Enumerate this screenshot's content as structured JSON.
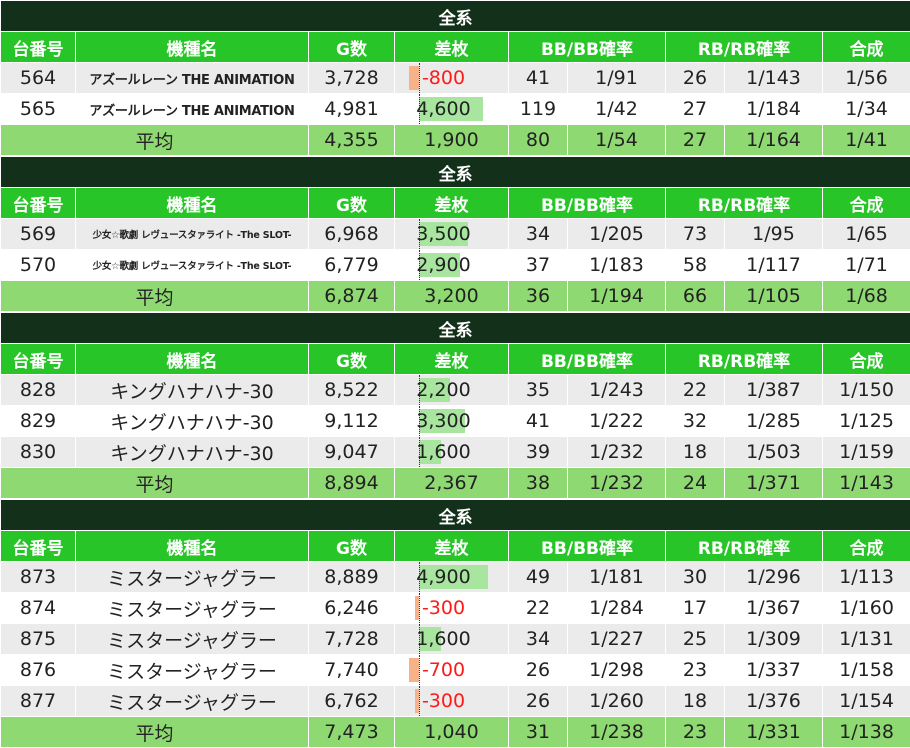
{
  "groups": [
    {
      "title": "全系",
      "headers": [
        "台番号",
        "機種名",
        "G数",
        "差枚",
        "BB/BB確率",
        "RB/RB確率",
        "合成"
      ],
      "rows": [
        {
          "num": "564",
          "name": "アズールレーン THE ANIMATION",
          "name_size": "small",
          "games": "3,728",
          "diff": "-800",
          "diff_value": -800,
          "bb": "41",
          "bb_rate": "1/91",
          "rb": "26",
          "rb_rate": "1/143",
          "total": "1/56"
        },
        {
          "num": "565",
          "name": "アズールレーン THE ANIMATION",
          "name_size": "small",
          "games": "4,981",
          "diff": "4,600",
          "diff_value": 4600,
          "bb": "119",
          "bb_rate": "1/42",
          "rb": "27",
          "rb_rate": "1/184",
          "total": "1/34"
        }
      ],
      "avg": {
        "label": "平均",
        "games": "4,355",
        "diff": "1,900",
        "bb": "80",
        "bb_rate": "1/54",
        "rb": "27",
        "rb_rate": "1/164",
        "total": "1/41"
      }
    },
    {
      "title": "全系",
      "headers": [
        "台番号",
        "機種名",
        "G数",
        "差枚",
        "BB/BB確率",
        "RB/RB確率",
        "合成"
      ],
      "rows": [
        {
          "num": "569",
          "name": "少女☆歌劇 レヴュースタァライト -The SLOT-",
          "name_size": "tiny",
          "games": "6,968",
          "diff": "3,500",
          "diff_value": 3500,
          "bb": "34",
          "bb_rate": "1/205",
          "rb": "73",
          "rb_rate": "1/95",
          "total": "1/65"
        },
        {
          "num": "570",
          "name": "少女☆歌劇 レヴュースタァライト -The SLOT-",
          "name_size": "tiny",
          "games": "6,779",
          "diff": "2,900",
          "diff_value": 2900,
          "bb": "37",
          "bb_rate": "1/183",
          "rb": "58",
          "rb_rate": "1/117",
          "total": "1/71"
        }
      ],
      "avg": {
        "label": "平均",
        "games": "6,874",
        "diff": "3,200",
        "bb": "36",
        "bb_rate": "1/194",
        "rb": "66",
        "rb_rate": "1/105",
        "total": "1/68"
      }
    },
    {
      "title": "全系",
      "headers": [
        "台番号",
        "機種名",
        "G数",
        "差枚",
        "BB/BB確率",
        "RB/RB確率",
        "合成"
      ],
      "rows": [
        {
          "num": "828",
          "name": "キングハナハナ-30",
          "name_size": "normal",
          "games": "8,522",
          "diff": "2,200",
          "diff_value": 2200,
          "bb": "35",
          "bb_rate": "1/243",
          "rb": "22",
          "rb_rate": "1/387",
          "total": "1/150"
        },
        {
          "num": "829",
          "name": "キングハナハナ-30",
          "name_size": "normal",
          "games": "9,112",
          "diff": "3,300",
          "diff_value": 3300,
          "bb": "41",
          "bb_rate": "1/222",
          "rb": "32",
          "rb_rate": "1/285",
          "total": "1/125"
        },
        {
          "num": "830",
          "name": "キングハナハナ-30",
          "name_size": "normal",
          "games": "9,047",
          "diff": "1,600",
          "diff_value": 1600,
          "bb": "39",
          "bb_rate": "1/232",
          "rb": "18",
          "rb_rate": "1/503",
          "total": "1/159"
        }
      ],
      "avg": {
        "label": "平均",
        "games": "8,894",
        "diff": "2,367",
        "bb": "38",
        "bb_rate": "1/232",
        "rb": "24",
        "rb_rate": "1/371",
        "total": "1/143"
      }
    },
    {
      "title": "全系",
      "headers": [
        "台番号",
        "機種名",
        "G数",
        "差枚",
        "BB/BB確率",
        "RB/RB確率",
        "合成"
      ],
      "rows": [
        {
          "num": "873",
          "name": "ミスタージャグラー",
          "name_size": "normal",
          "games": "8,889",
          "diff": "4,900",
          "diff_value": 4900,
          "bb": "49",
          "bb_rate": "1/181",
          "rb": "30",
          "rb_rate": "1/296",
          "total": "1/113"
        },
        {
          "num": "874",
          "name": "ミスタージャグラー",
          "name_size": "normal",
          "games": "6,246",
          "diff": "-300",
          "diff_value": -300,
          "bb": "22",
          "bb_rate": "1/284",
          "rb": "17",
          "rb_rate": "1/367",
          "total": "1/160"
        },
        {
          "num": "875",
          "name": "ミスタージャグラー",
          "name_size": "normal",
          "games": "7,728",
          "diff": "1,600",
          "diff_value": 1600,
          "bb": "34",
          "bb_rate": "1/227",
          "rb": "25",
          "rb_rate": "1/309",
          "total": "1/131"
        },
        {
          "num": "876",
          "name": "ミスタージャグラー",
          "name_size": "normal",
          "games": "7,740",
          "diff": "-700",
          "diff_value": -700,
          "bb": "26",
          "bb_rate": "1/298",
          "rb": "23",
          "rb_rate": "1/337",
          "total": "1/158"
        },
        {
          "num": "877",
          "name": "ミスタージャグラー",
          "name_size": "normal",
          "games": "6,762",
          "diff": "-300",
          "diff_value": -300,
          "bb": "26",
          "bb_rate": "1/260",
          "rb": "18",
          "rb_rate": "1/376",
          "total": "1/154"
        }
      ],
      "avg": {
        "label": "平均",
        "games": "7,473",
        "diff": "1,040",
        "bb": "31",
        "bb_rate": "1/238",
        "rb": "23",
        "rb_rate": "1/331",
        "total": "1/138"
      }
    }
  ],
  "colors": {
    "title_bg": "#12301a",
    "header_bg": "#27c527",
    "avg_bg": "#8fd972",
    "positive_bar": "#a8e6a0",
    "negative_bar": "#f7b28a",
    "negative_text": "#ff1a1a"
  }
}
